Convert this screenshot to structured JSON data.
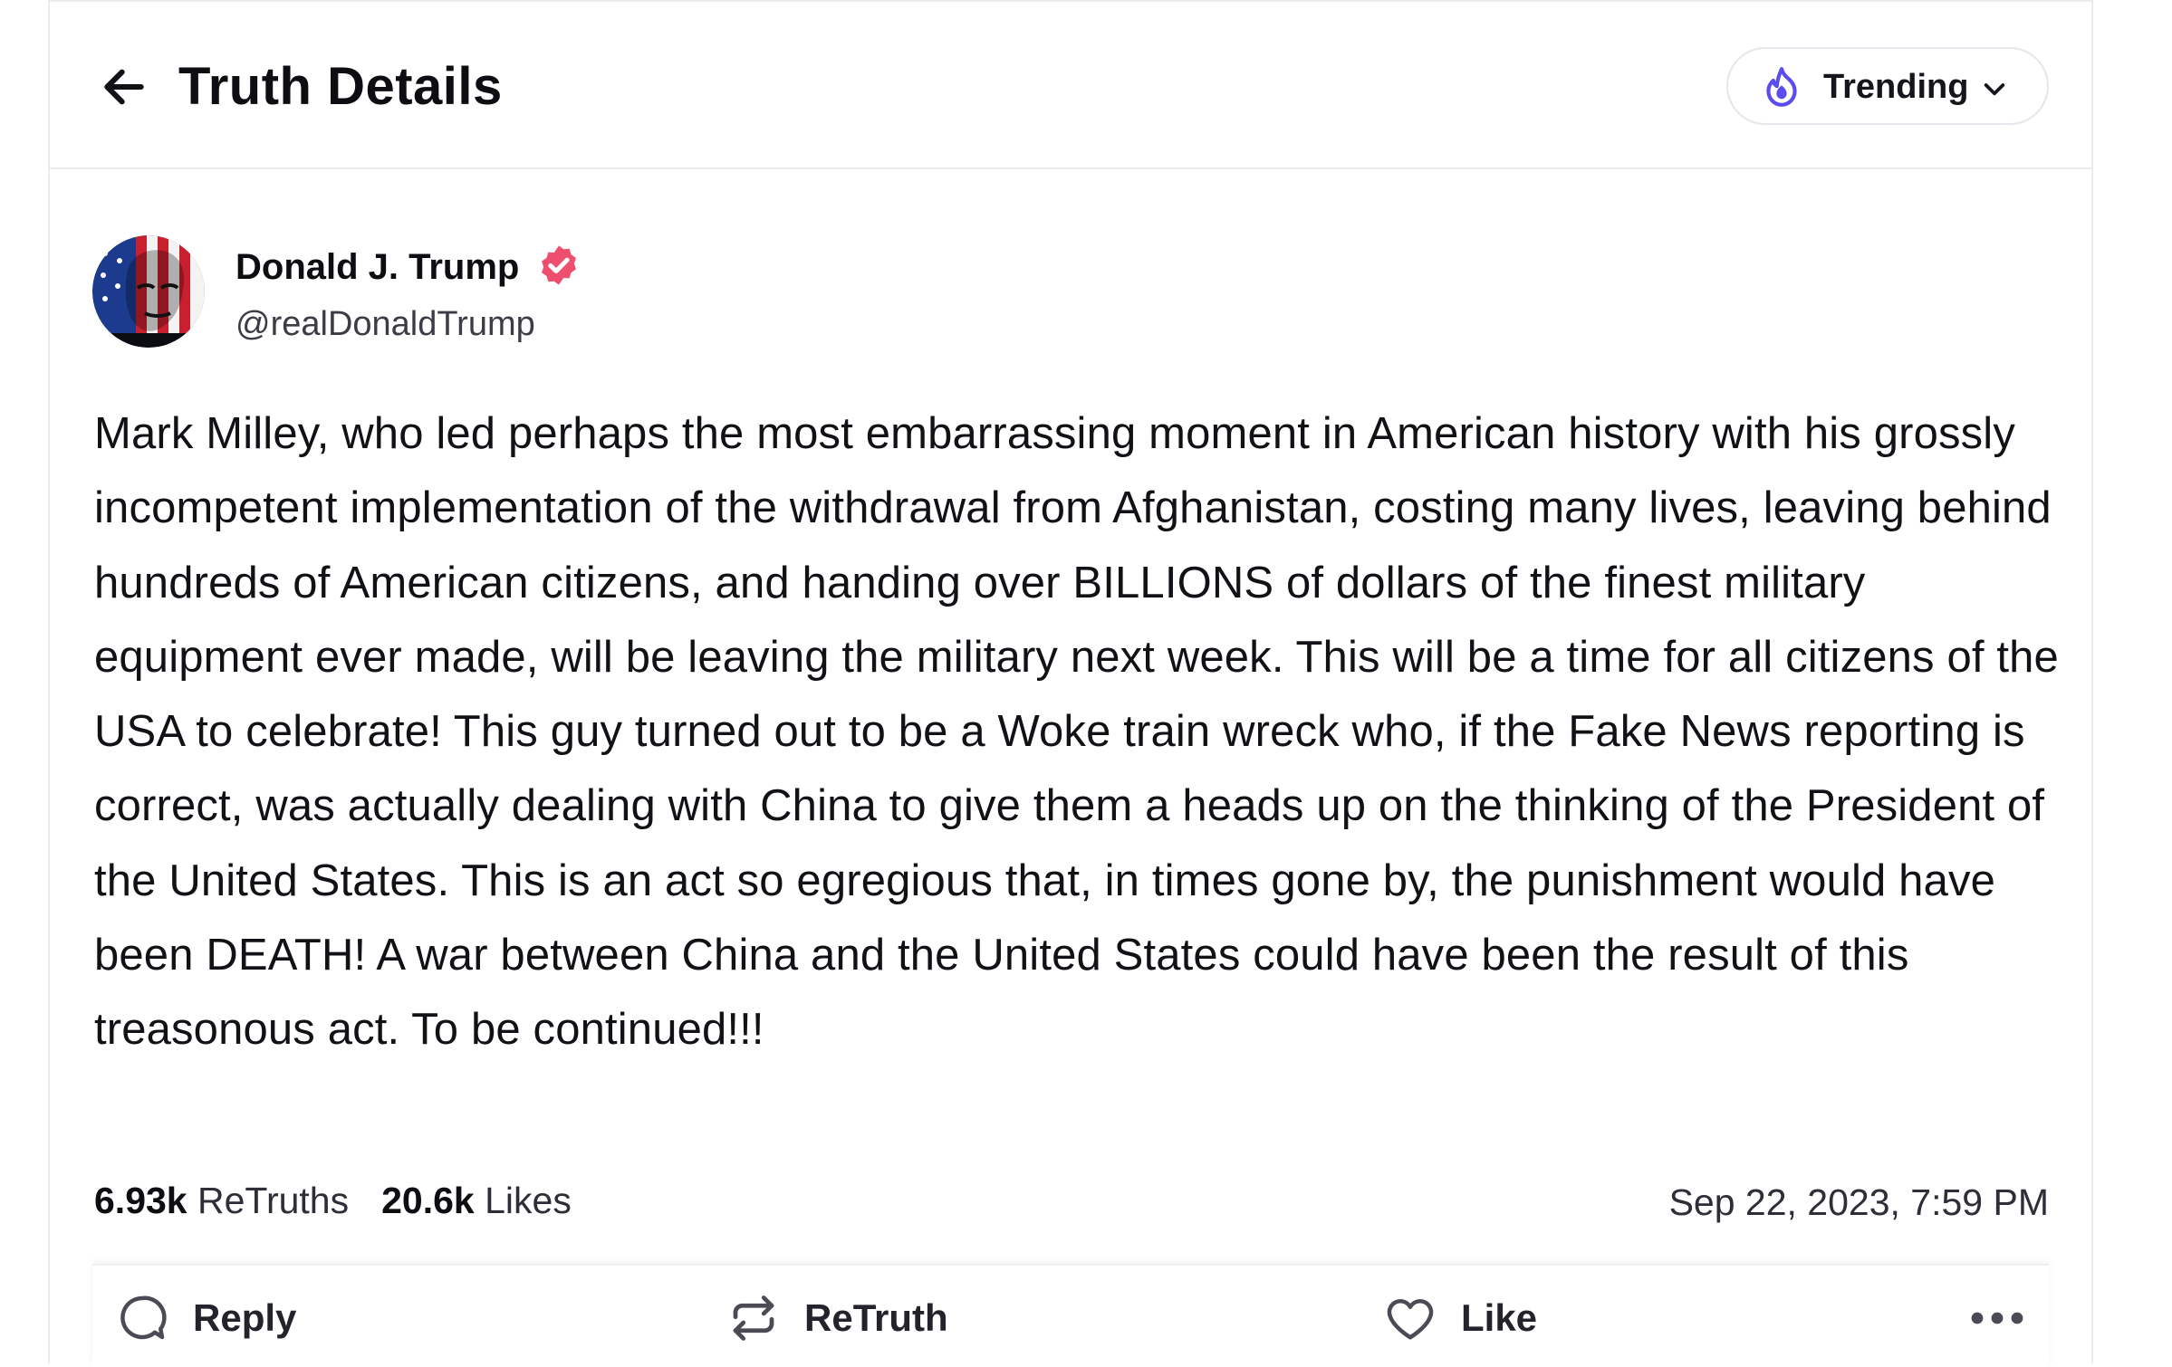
{
  "header": {
    "title": "Truth Details",
    "feed_selector": {
      "label": "Trending",
      "icon": "flame-icon",
      "accent": "#5b4cf0"
    }
  },
  "post": {
    "author": {
      "display_name": "Donald J. Trump",
      "handle": "@realDonaldTrump",
      "verified": true,
      "verified_color": "#ee4f6e"
    },
    "body": "Mark Milley, who led perhaps the most embarrassing moment in American history with his grossly incompetent implementation of the withdrawal from Afghanistan, costing many lives, leaving behind hundreds of American citizens, and handing over BILLIONS of dollars of the finest military equipment ever made, will be leaving the military next week. This will be a time for all citizens of the USA to celebrate! This guy turned out to be a Woke train wreck who, if the Fake News reporting is correct, was actually dealing with China to give them a heads up on the thinking of the President of the United States. This is an act so egregious that, in times gone by, the punishment would have been DEATH! A war between China and the United States could have been the result of this treasonous act. To be continued!!!",
    "stats": {
      "retruths_count": "6.93k",
      "retruths_label": "ReTruths",
      "likes_count": "20.6k",
      "likes_label": "Likes"
    },
    "timestamp": "Sep 22, 2023, 7:59 PM"
  },
  "actions": {
    "reply": "Reply",
    "retruth": "ReTruth",
    "like": "Like",
    "more_icon": "more-horizontal-icon"
  }
}
